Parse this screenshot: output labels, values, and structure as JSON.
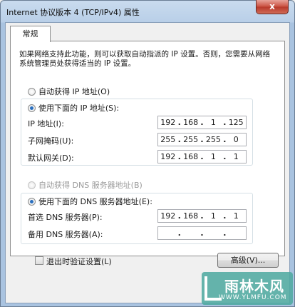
{
  "window": {
    "title": "Internet 协议版本 4 (TCP/IPv4) 属性",
    "close_label": "x"
  },
  "tabs": [
    {
      "label": "常规"
    }
  ],
  "description": "如果网络支持此功能，则可以获取自动指派的 IP 设置。否则，您需要从网络系统管理员处获得适当的 IP 设置。",
  "ip_section": {
    "auto_label": "自动获得 IP 地址(O)",
    "manual_label": "使用下面的 IP 地址(S):",
    "selected": "manual",
    "fields": [
      {
        "label": "IP 地址(I):",
        "octets": [
          "192",
          "168",
          "1",
          "125"
        ]
      },
      {
        "label": "子网掩码(U):",
        "octets": [
          "255",
          "255",
          "255",
          "0"
        ]
      },
      {
        "label": "默认网关(D):",
        "octets": [
          "192",
          "168",
          "1",
          "1"
        ]
      }
    ]
  },
  "dns_section": {
    "auto_label": "自动获得 DNS 服务器地址(B)",
    "manual_label": "使用下面的 DNS 服务器地址(E):",
    "selected": "manual",
    "fields": [
      {
        "label": "首选 DNS 服务器(P):",
        "octets": [
          "192",
          "168",
          "1",
          "1"
        ]
      },
      {
        "label": "备用 DNS 服务器(A):",
        "octets": [
          "",
          "",
          "",
          ""
        ]
      }
    ]
  },
  "validate_on_exit": {
    "label": "退出时验证设置(L)",
    "checked": false
  },
  "advanced_button": "高级(V)...",
  "watermark": {
    "title": "雨林木风",
    "url": "WWW.YLMFU.COM"
  }
}
